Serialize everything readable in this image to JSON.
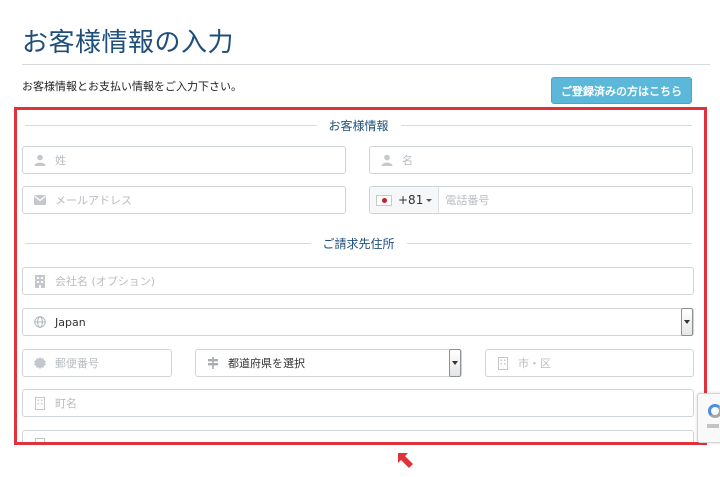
{
  "header": {
    "title": "お客様情報の入力",
    "subtitle": "お客様情報とお支払い情報をご入力下さい。",
    "login_button": "ご登録済みの方はこちら"
  },
  "sections": {
    "customer_info": "お客様情報",
    "billing_address": "ご請求先住所"
  },
  "fields": {
    "last_name": {
      "placeholder": "姓",
      "icon": "user-icon"
    },
    "first_name": {
      "placeholder": "名",
      "icon": "user-icon"
    },
    "email": {
      "placeholder": "メールアドレス",
      "icon": "envelope-icon"
    },
    "phone": {
      "country_code": "+81",
      "placeholder": "電話番号",
      "flag": "japan-flag-icon"
    },
    "company": {
      "placeholder": "会社名 (オプション)",
      "icon": "building-icon"
    },
    "country": {
      "value": "Japan",
      "icon": "globe-icon"
    },
    "postal_code": {
      "placeholder": "郵便番号",
      "icon": "badge-icon"
    },
    "prefecture": {
      "value": "都道府県を選択",
      "icon": "signpost-icon"
    },
    "city": {
      "placeholder": "市・区",
      "icon": "building-icon"
    },
    "town": {
      "placeholder": "町名",
      "icon": "building-icon"
    }
  },
  "colors": {
    "title": "#1e4f7c",
    "login_button": "#5bb8d9",
    "highlight_border": "#e0323a",
    "icon": "#c4c8cc"
  }
}
